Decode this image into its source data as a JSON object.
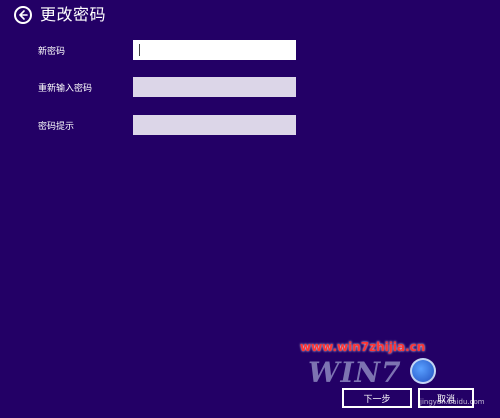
{
  "header": {
    "title": "更改密码"
  },
  "form": {
    "new_password_label": "新密码",
    "confirm_password_label": "重新输入密码",
    "hint_label": "密码提示",
    "new_password_value": "",
    "confirm_password_value": "",
    "hint_value": ""
  },
  "footer": {
    "next_label": "下一步",
    "cancel_label": "取消"
  },
  "watermark": {
    "url": "www.win7zhijia.cn",
    "logo_text": "WIN7",
    "baidu": "jingyan.baidu.com"
  },
  "colors": {
    "background": "#230066",
    "active_field": "#ffffff",
    "inactive_field": "#dcd6e8"
  },
  "icons": {
    "back": "back-arrow-icon"
  }
}
